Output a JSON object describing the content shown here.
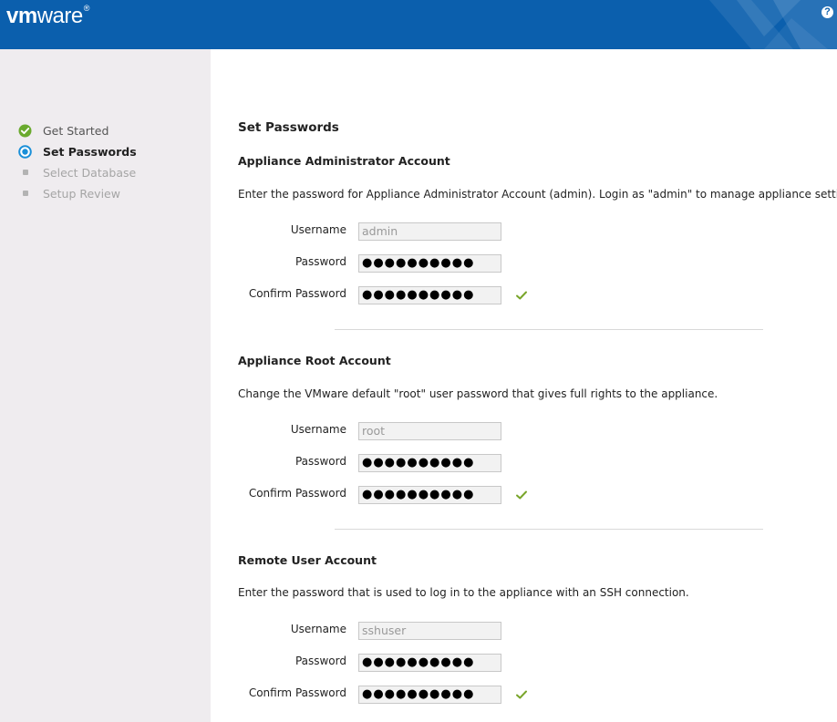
{
  "header": {
    "logo_bold": "vm",
    "logo_light": "ware",
    "logo_reg": "®",
    "help_label": "?"
  },
  "steps": [
    {
      "label": "Get Started",
      "state": "done"
    },
    {
      "label": "Set Passwords",
      "state": "active"
    },
    {
      "label": "Select Database",
      "state": "pending"
    },
    {
      "label": "Setup Review",
      "state": "pending"
    }
  ],
  "page_title": "Set Passwords",
  "sections": {
    "admin": {
      "title": "Appliance Administrator Account",
      "description": "Enter the password for Appliance Administrator Account (admin). Login as \"admin\" to manage appliance settings.",
      "username_label": "Username",
      "password_label": "Password",
      "confirm_label": "Confirm Password",
      "username_value": "admin",
      "password_value": "●●●●●●●●●●",
      "confirm_value": "●●●●●●●●●●"
    },
    "root": {
      "title": "Appliance Root Account",
      "description": "Change the VMware default \"root\" user password that gives full rights to the appliance.",
      "username_label": "Username",
      "password_label": "Password",
      "confirm_label": "Confirm Password",
      "username_value": "root",
      "password_value": "●●●●●●●●●●",
      "confirm_value": "●●●●●●●●●●"
    },
    "remote": {
      "title": "Remote User Account",
      "description": "Enter the password that is used to log in to the appliance with an SSH connection.",
      "username_label": "Username",
      "password_label": "Password",
      "confirm_label": "Confirm Password",
      "username_value": "sshuser",
      "password_value": "●●●●●●●●●●",
      "confirm_value": "●●●●●●●●●●"
    }
  },
  "colors": {
    "header": "#0b5fad",
    "sidebar": "#efecef",
    "done_green": "#6aaa2e",
    "active_blue": "#1a8fd8",
    "check_green": "#79a52a"
  }
}
